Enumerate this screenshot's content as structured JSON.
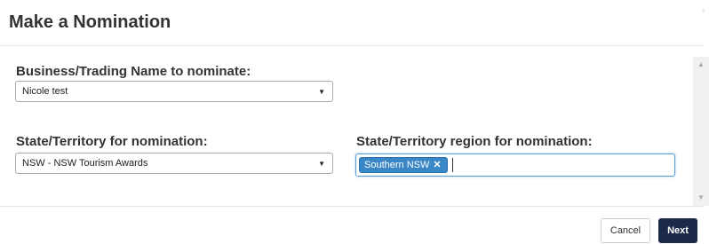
{
  "dialog": {
    "title": "Make a Nomination",
    "close_glyph": "›"
  },
  "form": {
    "business_label": "Business/Trading Name to nominate:",
    "business_value": "Nicole test",
    "state_label": "State/Territory for nomination:",
    "state_value": "NSW - NSW Tourism  Awards",
    "region_label": "State/Territory region for nomination:",
    "region_tags": [
      "Southern NSW"
    ],
    "tag_remove_glyph": "✕"
  },
  "footer": {
    "cancel_label": "Cancel",
    "next_label": "Next"
  },
  "colors": {
    "primary_button": "#1c2a4a",
    "tag_bg": "#3a87c8",
    "focus_border": "#5b9dd9"
  }
}
